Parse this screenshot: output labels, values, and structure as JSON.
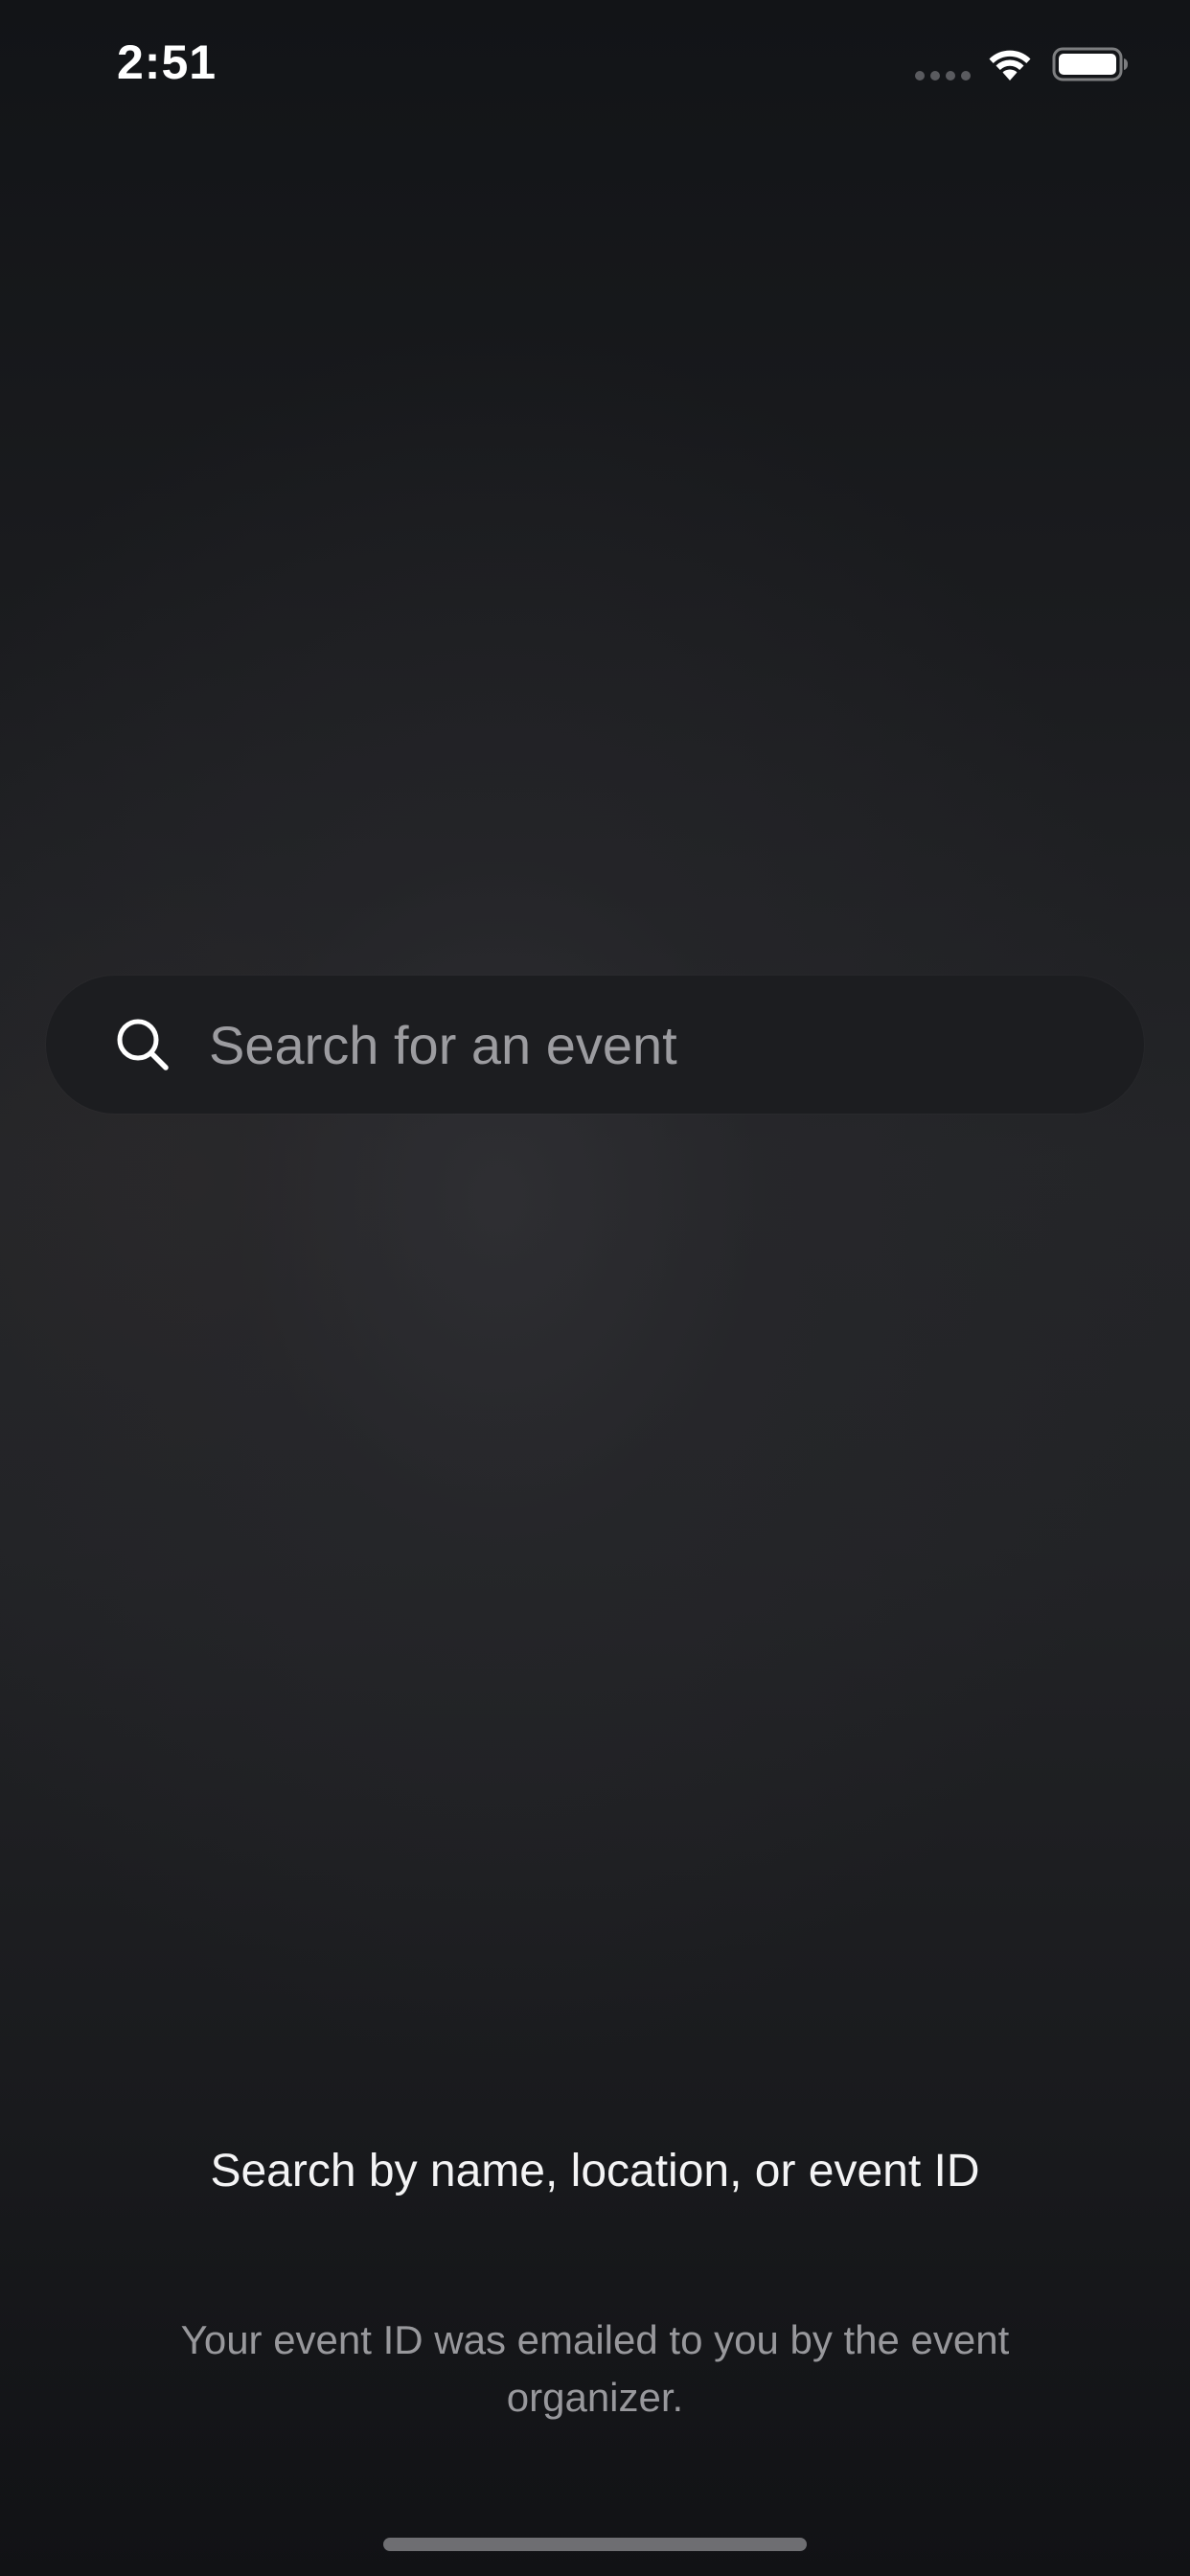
{
  "status_bar": {
    "time": "2:51",
    "icons": [
      "cellular-signal-icon",
      "wifi-icon",
      "battery-icon"
    ]
  },
  "search": {
    "placeholder": "Search for an event",
    "value": "",
    "icon": "search-icon"
  },
  "help": {
    "title": "Search by name, location, or event ID",
    "subtitle": "Your event ID was emailed to you by the event organizer."
  },
  "colors": {
    "background": "#131417",
    "search_field": "#1c1d20",
    "primary_text": "#f4f4f5",
    "secondary_text": "#98989c"
  }
}
